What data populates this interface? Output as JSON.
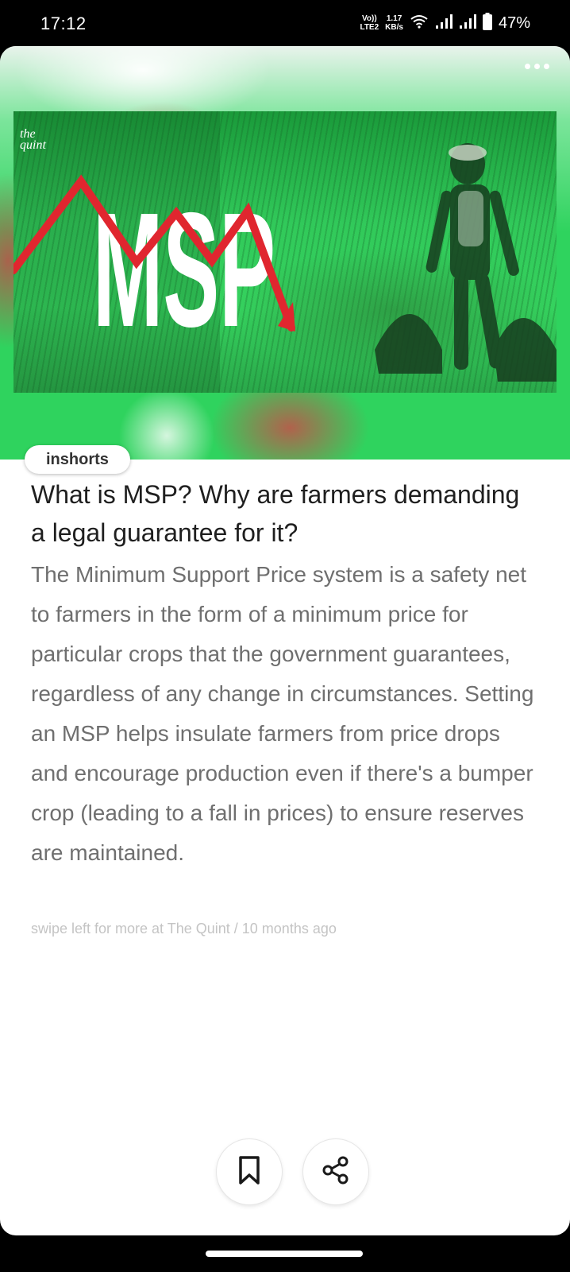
{
  "status_bar": {
    "time": "17:12",
    "volte_top": "Vo))",
    "volte_bottom": "LTE2",
    "speed_top": "1.17",
    "speed_bottom": "KB/s",
    "battery_percent": "47%",
    "icons": [
      "wifi-icon",
      "signal-icon",
      "signal-icon",
      "battery-icon"
    ]
  },
  "article": {
    "image": {
      "logo_line1": "the",
      "logo_line2": "quint",
      "headline_text": "MSP"
    },
    "source": "inshorts",
    "title": "What is MSP? Why are farmers demanding a legal guarantee for it?",
    "body": "The Minimum Support Price system is a safety net to farmers in the form of a minimum price for particular crops that the government guarantees, regardless of any change in circumstances. Setting an MSP helps insulate farmers from price drops and encourage production even if there's a bumper crop (leading to a fall in prices) to ensure reserves are maintained.",
    "footer": "swipe left for more at The Quint / 10 months ago"
  },
  "actions": {
    "icons": [
      "more-options-icon",
      "bookmark-icon",
      "share-icon"
    ]
  },
  "colors": {
    "accent_green": "#2fd35e",
    "arrow_red": "#e0262f",
    "body_text": "#6f6f6f",
    "footer_text": "#c4c4c4"
  }
}
